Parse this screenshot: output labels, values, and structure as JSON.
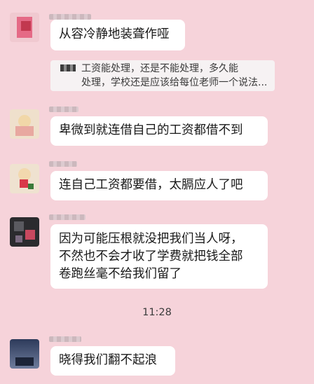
{
  "messages": [
    {
      "text": "从容冷静地装聋作哑",
      "quote": "工资能处理，还是不能处理，多久能\n处理，学校还是应该给每位老师一个说法..."
    },
    {
      "text": "卑微到就连借自己的工资都借不到"
    },
    {
      "text": "连自己工资都要借，太膈应人了吧"
    },
    {
      "text": "因为可能压根就没把我们当人呀，\n不然也不会才收了学费就把钱全部\n卷跑丝毫不给我们留了"
    },
    {
      "text": "晓得我们翻不起浪"
    }
  ],
  "timestamp": "11:28",
  "colors": {
    "background": "#f6d3da",
    "bubble": "#ffffff",
    "quote": "#f6f2f3"
  }
}
